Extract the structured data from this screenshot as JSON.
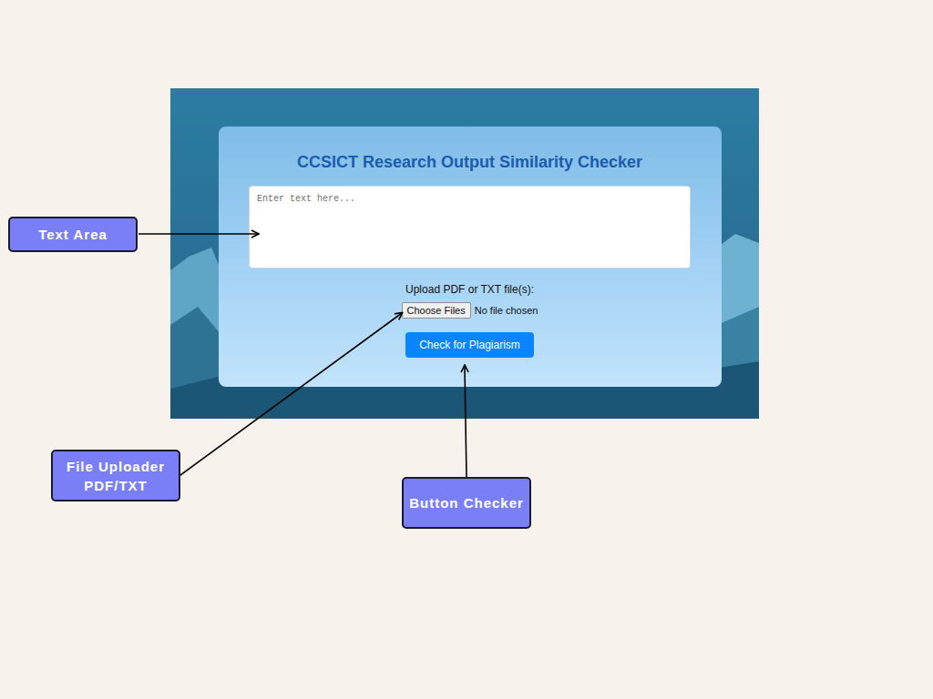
{
  "screenshot": {
    "title": "CCSICT Research Output Similarity Checker",
    "textarea": {
      "placeholder": "Enter text here..."
    },
    "upload": {
      "label": "Upload PDF or TXT file(s):",
      "button": "Choose Files",
      "status": "No file chosen"
    },
    "check_button": "Check for Plagiarism"
  },
  "annotations": [
    {
      "lines": [
        "Text Area"
      ]
    },
    {
      "lines": [
        "File Uploader",
        "PDF/TXT"
      ]
    },
    {
      "lines": [
        "Button Checker"
      ]
    }
  ]
}
